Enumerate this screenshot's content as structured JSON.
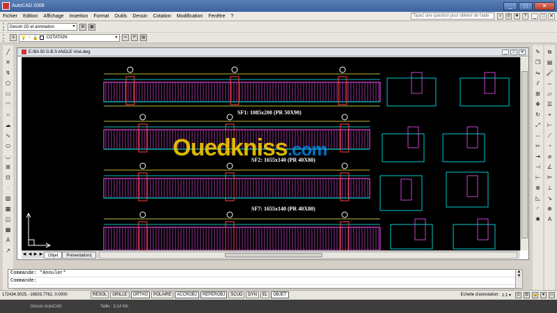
{
  "window": {
    "title": "AutoCAD 2008",
    "controls": [
      "_",
      "□",
      "✕"
    ]
  },
  "menu": {
    "items": [
      "Fichier",
      "Edition",
      "Affichage",
      "Insertion",
      "Format",
      "Outils",
      "Dessin",
      "Cotation",
      "Modification",
      "Fenêtre",
      "?"
    ],
    "help_placeholder": "Tapez une question pour obtenir de l'aide",
    "inner_controls": [
      "_",
      "□",
      "✕"
    ]
  },
  "toolbar1": {
    "workspace_label": "Dessin 2D et annotation"
  },
  "toolbar2": {
    "layer_label": "COTATION"
  },
  "drawing_window": {
    "title": "E:\\BA 50 G.B.S ANGLE Visé.dwg",
    "controls": [
      "_",
      "□",
      "✕"
    ],
    "tabs": [
      "Objet",
      "Présentation1"
    ],
    "nav_arrows": [
      "◀",
      "◀",
      "▶",
      "▶"
    ]
  },
  "drawing": {
    "labels": [
      "SF1: 1085x200 (PR 50X90)",
      "SF2: 1655x140 (PR 40X80)",
      "SF7: 1655x140 (PR 40X80)"
    ],
    "watermark_main": "Ouedkniss",
    "watermark_domain": ".com"
  },
  "command": {
    "history": "Commande: *Annuler*",
    "prompt": "Commande:"
  },
  "statusbar": {
    "coords": "172434.5025, -16503.7762, 0.0000",
    "buttons": [
      "RESOL",
      "GRILLE",
      "ORTHO",
      "POLAIRE",
      "ACCROBJ",
      "REPEROBJ",
      "SCUD",
      "DYN",
      "EL",
      "OBJET"
    ],
    "annotation_label": "Echelle d'annotation:",
    "annotation_scale": "1:1 ▾"
  },
  "footer": {
    "file_type": "Dessin AutoCAD",
    "file_size": "Taille : 3,14 Mo"
  },
  "colors": {
    "canvas": "#000000",
    "title_blue": "#3c63a0"
  }
}
